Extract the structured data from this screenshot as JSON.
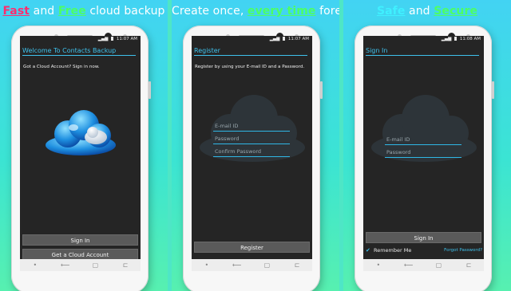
{
  "panels": [
    {
      "headline": {
        "fast": "Fast",
        "and": " and ",
        "free": "Free",
        "rest": " cloud backup"
      },
      "status_time": "11:07 AM",
      "title": "Welcome To Contacts Backup",
      "intro": "Got a Cloud Account? Sign in now.",
      "buttons": {
        "sign_in": "Sign In",
        "get_account": "Get a Cloud Account"
      }
    },
    {
      "headline": {
        "pre": "Create once, ",
        "mid": "every time",
        "post": " forever"
      },
      "status_time": "11:07 AM",
      "title": "Register",
      "intro": "Register by using your E-mail ID and a Password.",
      "fields": {
        "email": "E-mail ID",
        "password": "Password",
        "confirm": "Confirm Password"
      },
      "buttons": {
        "register": "Register"
      }
    },
    {
      "headline": {
        "safe": "Safe",
        "and": " and ",
        "secure": "Secure"
      },
      "status_time": "11:08 AM",
      "title": "Sign In",
      "fields": {
        "email": "E-mail ID",
        "password": "Password"
      },
      "buttons": {
        "sign_in": "Sign In"
      },
      "remember_me": "Remember Me",
      "forgot_password": "Forgot Password?"
    }
  ],
  "navbar": {
    "dot": "•",
    "back": "⟵",
    "home": "▢",
    "recent": "⊏"
  },
  "icons": {
    "cloud": "cloud-icon",
    "wifi": "wifi-icon",
    "signal": "signal-icon",
    "battery": "battery-icon"
  },
  "colors": {
    "accent": "#3ec1ec",
    "red_headline": "#ff2d6f",
    "green_headline": "#4dff64",
    "screen_bg": "#252525"
  }
}
